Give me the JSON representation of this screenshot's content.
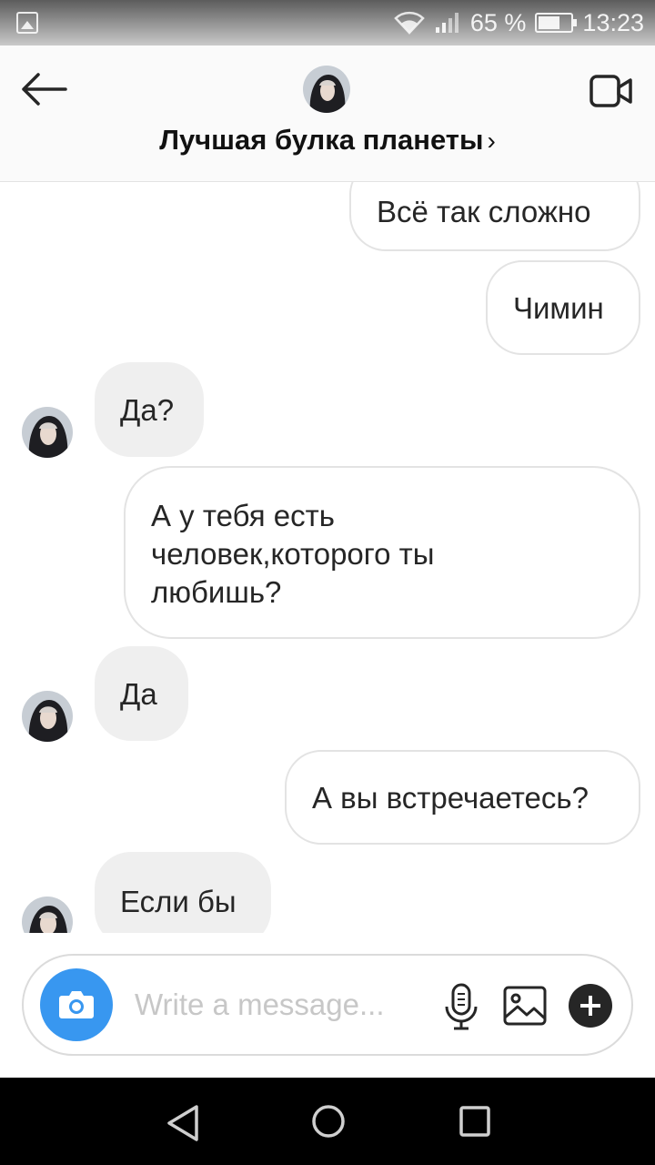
{
  "status_bar": {
    "signal_percent": "65 %",
    "battery_level": 0.65,
    "time": "13:23",
    "icons": [
      "gallery-icon",
      "wifi-icon",
      "signal-icon",
      "battery-icon"
    ]
  },
  "header": {
    "title": "Лучшая булка планеты",
    "chevron": "›",
    "icons": [
      "back-arrow-icon",
      "avatar",
      "video-call-icon"
    ]
  },
  "messages": [
    {
      "direction": "out",
      "text": "Всё так сложно"
    },
    {
      "direction": "out",
      "text": "Чимин"
    },
    {
      "direction": "in",
      "text": "Да?"
    },
    {
      "direction": "out",
      "text_lines": [
        "А у тебя есть",
        "человек,которого ты",
        "любишь?"
      ]
    },
    {
      "direction": "in",
      "text": "Да"
    },
    {
      "direction": "out",
      "text": "А вы встречаетесь?"
    },
    {
      "direction": "in",
      "text": "Если бы"
    }
  ],
  "composer": {
    "placeholder": "Write a message...",
    "icons": [
      "camera-icon",
      "microphone-icon",
      "image-icon",
      "plus-icon"
    ]
  },
  "navbar": {
    "icons": [
      "nav-back-icon",
      "nav-home-icon",
      "nav-recents-icon"
    ]
  },
  "colors": {
    "accent": "#3897f0",
    "incoming_bubble": "#efefef",
    "outgoing_border": "#e3e3e3",
    "text": "#262626",
    "placeholder": "#c7c7c7"
  }
}
